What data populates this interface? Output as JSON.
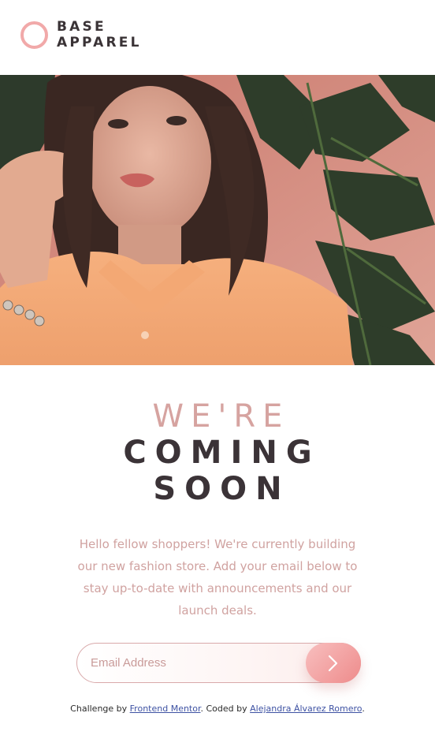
{
  "brand": {
    "line1": "BASE",
    "line2": "APPAREL",
    "accent_color": "#f1a9a9"
  },
  "hero": {
    "icon": "hero-photo-woman"
  },
  "headline": {
    "light": "WE'RE",
    "bold_line1": "COMING",
    "bold_line2": "SOON"
  },
  "description": "Hello fellow shoppers! We're currently building our new fashion store. Add your email below to stay up-to-date with announcements and our launch deals.",
  "form": {
    "email_placeholder": "Email Address",
    "submit_icon": "arrow-right-icon"
  },
  "attribution": {
    "prefix": "Challenge by",
    "link1": "Frontend Mentor",
    "middle": ". Coded by",
    "link2": "Alejandra Álvarez Romero",
    "suffix": "."
  },
  "colors": {
    "text_dark": "#3b3337",
    "text_pink": "#d6a3a0",
    "button_gradient_start": "#f8bfbf",
    "button_gradient_end": "#ee8b8b"
  }
}
